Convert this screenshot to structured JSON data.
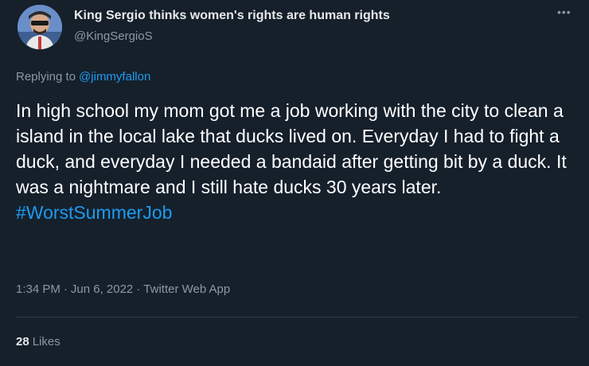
{
  "author": {
    "display_name": "King Sergio thinks women's rights are human rights",
    "handle": "@KingSergioS",
    "avatar_icon": "profile-photo"
  },
  "more_icon": "ellipsis-icon",
  "reply": {
    "prefix": "Replying to",
    "mention": "@jimmyfallon"
  },
  "tweet": {
    "text": "In high school my mom got me a job working with the city to clean a island in the local lake that ducks lived on. Everyday I had to fight a duck, and everyday I needed a bandaid after getting bit by a duck. It was a nightmare and I still hate ducks 30 years later.",
    "hashtag": "#WorstSummerJob"
  },
  "meta": {
    "time": "1:34 PM",
    "separator": "·",
    "date": "Jun 6, 2022",
    "source": "Twitter Web App"
  },
  "stats": {
    "likes_count": "28",
    "likes_label": "Likes"
  },
  "colors": {
    "background": "#15202b",
    "link": "#1d9bf0",
    "secondary_text": "#8b98a5"
  }
}
